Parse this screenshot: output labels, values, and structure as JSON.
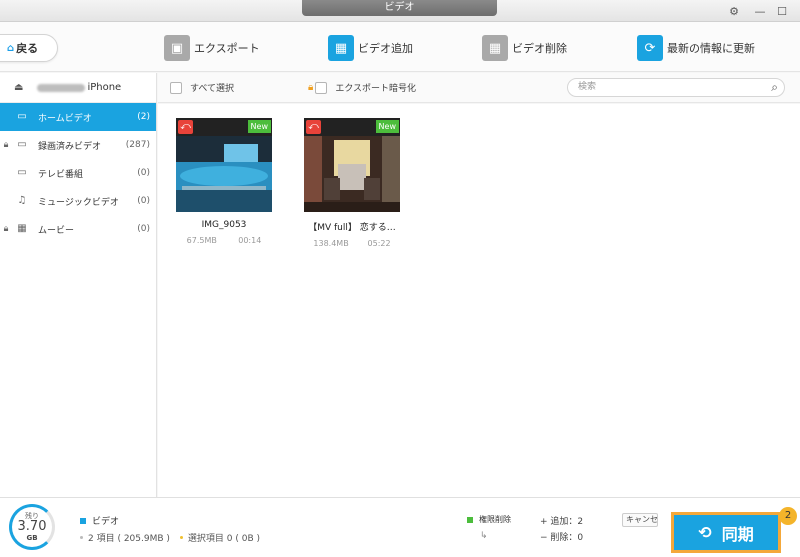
{
  "window": {
    "title": "ビデオ"
  },
  "toolbar": {
    "back_label": "戻る",
    "export_label": "エクスポート",
    "add_label": "ビデオ追加",
    "delete_label": "ビデオ削除",
    "refresh_label": "最新の情報に更新"
  },
  "sidebar": {
    "device_name": "iPhone",
    "items": [
      {
        "label": "ホームビデオ",
        "count": "(2)"
      },
      {
        "label": "録画済みビデオ",
        "count": "(287)"
      },
      {
        "label": "テレビ番組",
        "count": "(0)"
      },
      {
        "label": "ミュージックビデオ",
        "count": "(0)"
      },
      {
        "label": "ムービー",
        "count": "(0)"
      }
    ]
  },
  "content_header": {
    "select_all": "すべて選択",
    "encrypt_export": "エクスポート暗号化",
    "search_placeholder": "検索"
  },
  "videos": [
    {
      "name": "IMG_9053",
      "size": "67.5MB",
      "duration": "00:14",
      "badge": "New"
    },
    {
      "name": "【MV full】 恋する…",
      "size": "138.4MB",
      "duration": "05:22",
      "badge": "New"
    }
  ],
  "footer": {
    "storage_label": "残り",
    "storage_value": "3.70",
    "storage_unit": "GB",
    "category": "ビデオ",
    "items_summary": "2 項目 ( 205.9MB )",
    "selected_summary": "選択項目 0 ( 0B )",
    "perm_delete": "権限削除",
    "added": "+ 追加：2",
    "deleted": "− 削除：0",
    "cancel_label": "キャンセル",
    "sync_label": "同期",
    "sync_badge": "2"
  },
  "colors": {
    "accent": "#1aa3e0",
    "new_badge": "#4cbd3c",
    "undo_badge": "#e8433a",
    "sync_border": "#f4a83a"
  }
}
